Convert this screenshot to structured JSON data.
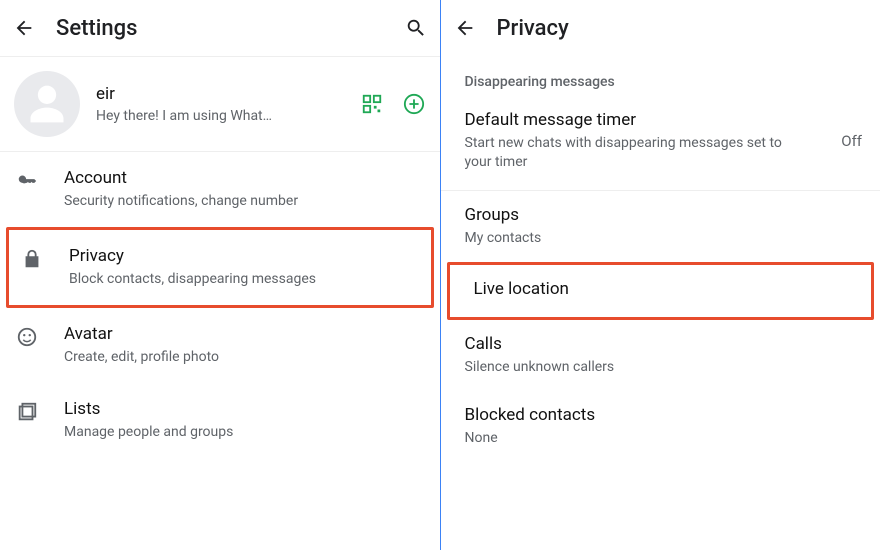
{
  "settings": {
    "title": "Settings",
    "profile": {
      "name": "eir",
      "status": "Hey there! I am using What…"
    },
    "items": [
      {
        "title": "Account",
        "subtitle": "Security notifications, change number"
      },
      {
        "title": "Privacy",
        "subtitle": "Block contacts, disappearing messages"
      },
      {
        "title": "Avatar",
        "subtitle": "Create, edit, profile photo"
      },
      {
        "title": "Lists",
        "subtitle": "Manage people and groups"
      }
    ]
  },
  "privacy": {
    "title": "Privacy",
    "section_label": "Disappearing messages",
    "default_timer": {
      "title": "Default message timer",
      "subtitle": "Start new chats with disappearing messages set to your timer",
      "value": "Off"
    },
    "items": [
      {
        "title": "Groups",
        "subtitle": "My contacts"
      },
      {
        "title": "Live location",
        "subtitle": ""
      },
      {
        "title": "Calls",
        "subtitle": "Silence unknown callers"
      },
      {
        "title": "Blocked contacts",
        "subtitle": "None"
      }
    ]
  }
}
